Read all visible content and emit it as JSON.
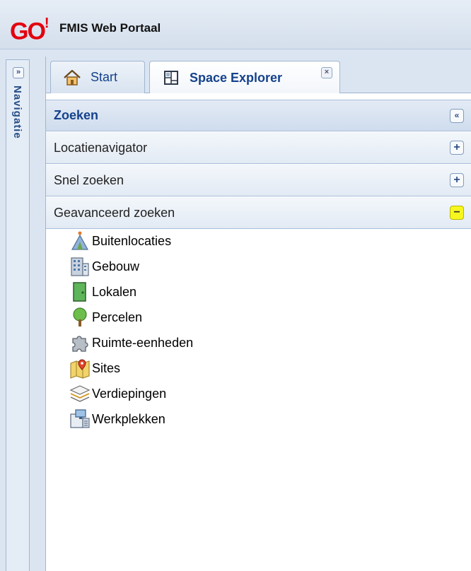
{
  "header": {
    "logo_text": "GO",
    "logo_mark": "!",
    "title": "FMIS Web Portaal"
  },
  "navigation": {
    "label": "Navigatie",
    "expand_glyph": "»"
  },
  "tabs": [
    {
      "label": "Start",
      "icon": "home-icon",
      "active": false
    },
    {
      "label": "Space Explorer",
      "icon": "floorplan-icon",
      "active": true,
      "closable": true
    }
  ],
  "panel": {
    "title": "Zoeken",
    "collapse_glyph": "«",
    "sections": [
      {
        "label": "Locatienavigator",
        "toggle": "+"
      },
      {
        "label": "Snel zoeken",
        "toggle": "+"
      },
      {
        "label": "Geavanceerd zoeken",
        "toggle": "−",
        "expanded": true
      }
    ]
  },
  "tree": [
    {
      "label": "Buitenlocaties",
      "icon": "outdoor-location-icon"
    },
    {
      "label": "Gebouw",
      "icon": "building-icon"
    },
    {
      "label": "Lokalen",
      "icon": "door-icon"
    },
    {
      "label": "Percelen",
      "icon": "tree-icon"
    },
    {
      "label": "Ruimte-eenheden",
      "icon": "puzzle-icon"
    },
    {
      "label": "Sites",
      "icon": "map-pin-icon"
    },
    {
      "label": "Verdiepingen",
      "icon": "layers-icon"
    },
    {
      "label": "Werkplekken",
      "icon": "workstation-icon"
    }
  ],
  "colors": {
    "accent": "#15428b",
    "logo": "#e3000f",
    "highlight": "#f7f71f"
  }
}
